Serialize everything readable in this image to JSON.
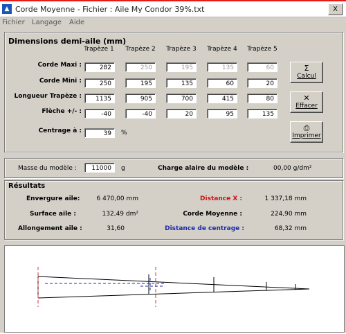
{
  "window": {
    "title": "Corde Moyenne - Fichier : Aile My Condor 39%.txt",
    "close": "X"
  },
  "menu": [
    "Fichier",
    "Langage",
    "Aide"
  ],
  "dimensions": {
    "title": "Dimensions demi-aile (mm)",
    "columns": [
      "Trapèze 1",
      "Trapèze 2",
      "Trapèze 3",
      "Trapèze 4",
      "Trapèze 5"
    ],
    "rows": [
      {
        "label": "Corde Maxi :",
        "values": [
          "282",
          "250",
          "195",
          "135",
          "60"
        ]
      },
      {
        "label": "Corde Mini :",
        "values": [
          "250",
          "195",
          "135",
          "60",
          "20"
        ]
      },
      {
        "label": "Longueur Trapèze :",
        "values": [
          "1135",
          "905",
          "700",
          "415",
          "80"
        ]
      },
      {
        "label": "Flèche +/- :",
        "values": [
          "-40",
          "-40",
          "20",
          "95",
          "135"
        ]
      }
    ],
    "centrage_label": "Centrage à :",
    "centrage_value": "39",
    "centrage_unit": "%"
  },
  "buttons": {
    "calcul": "Calcul",
    "effacer": "Effacer",
    "imprimer": "Imprimer"
  },
  "masse": {
    "label": "Masse du modèle :",
    "value": "11000",
    "unit": "g",
    "charge_label": "Charge alaire du modèle :",
    "charge_value": "00,00 g/dm²"
  },
  "resultats": {
    "title": "Résultats",
    "envergure_label": "Envergure aile:",
    "envergure_value": "6 470,00 mm",
    "distance_x_label": "Distance X :",
    "distance_x_value": "1 337,18 mm",
    "surface_label": "Surface aile :",
    "surface_value": "132,49 dm²",
    "corde_moyenne_label": "Corde Moyenne :",
    "corde_moyenne_value": "224,90 mm",
    "allongement_label": "Allongement aile :",
    "allongement_value": "31,60",
    "distance_centrage_label": "Distance de centrage :",
    "distance_centrage_value": "68,32 mm"
  },
  "colors": {
    "accent_red": "#cc1111",
    "accent_blue": "#1a2aa6",
    "top_bar": "#e41b17"
  }
}
